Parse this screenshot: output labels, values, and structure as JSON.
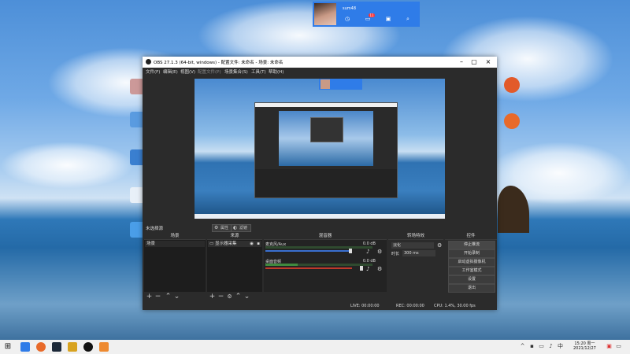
{
  "qq": {
    "username": "sum48",
    "badge_count": "11"
  },
  "obs": {
    "title": "OBS 27.1.3 (64-bit, windows) - 配置文件: 未命名 - 场景: 未命名",
    "menu": [
      "文件(F)",
      "编辑(E)",
      "视图(V)",
      "配置文件(P)",
      "场景集合(S)",
      "工具(T)",
      "帮助(H)"
    ],
    "current_scene": "未选择源",
    "props_label": "属性",
    "filters_label": "滤镜",
    "docks": {
      "scenes": {
        "title": "场景",
        "items": [
          "场景"
        ]
      },
      "sources": {
        "title": "来源",
        "items": [
          "显示器采集"
        ]
      },
      "mixer": {
        "title": "混音器",
        "channels": [
          {
            "name": "麦克风/Aux",
            "db": "0.0 dB"
          },
          {
            "name": "桌面音频",
            "db": "0.0 dB"
          }
        ]
      },
      "transitions": {
        "title": "转场特效",
        "type": "淡化",
        "duration_label": "时长",
        "duration": "300 ms"
      },
      "controls": {
        "title": "控件",
        "buttons": [
          "停止推流",
          "开始录制",
          "启动虚拟摄像机",
          "工作室模式",
          "设置",
          "退出"
        ]
      }
    },
    "status": {
      "live": "LIVE: 00:00:00",
      "rec": "REC: 00:00:00",
      "cpu": "CPU: 1.4%, 30.00 fps"
    }
  },
  "taskbar": {
    "time": "15:20 周一",
    "date": "2021/12/27"
  }
}
